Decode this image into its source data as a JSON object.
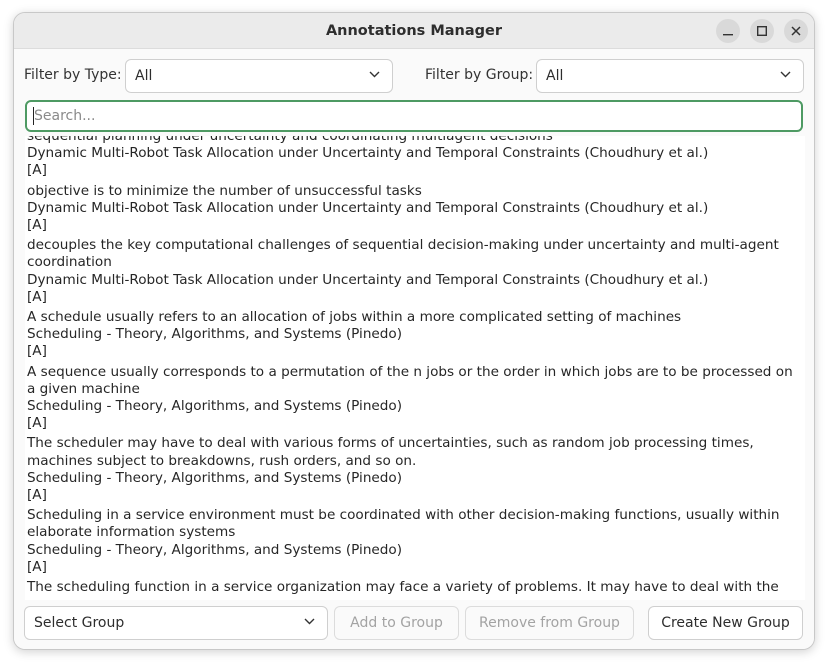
{
  "window": {
    "title": "Annotations Manager"
  },
  "filters": {
    "type_label": "Filter by Type:",
    "type_value": "All",
    "group_label": "Filter by Group:",
    "group_value": "All"
  },
  "search": {
    "placeholder": "Search..."
  },
  "annotations": [
    {
      "quote": "sequential planning under uncertainty and coordinating multiagent decisions",
      "source": "Dynamic Multi-Robot Task Allocation under Uncertainty and Temporal Constraints (Choudhury et al.)",
      "tag": "[A]"
    },
    {
      "quote": "objective is to minimize the number of unsuccessful tasks",
      "source": "Dynamic Multi-Robot Task Allocation under Uncertainty and Temporal Constraints (Choudhury et al.)",
      "tag": "[A]"
    },
    {
      "quote": "decouples the key computational challenges of sequential decision-making under uncertainty and multi-agent coordination",
      "source": "Dynamic Multi-Robot Task Allocation under Uncertainty and Temporal Constraints (Choudhury et al.)",
      "tag": "[A]"
    },
    {
      "quote": "A schedule usually refers to an allocation of jobs within a more complicated setting of machines",
      "source": "Scheduling - Theory, Algorithms, and Systems (Pinedo)",
      "tag": "[A]"
    },
    {
      "quote": "A sequence usually corresponds to a permutation of the n jobs or the order in which jobs are to be processed on a given machine",
      "source": "Scheduling - Theory, Algorithms, and Systems (Pinedo)",
      "tag": "[A]"
    },
    {
      "quote": "The scheduler may have to deal with various forms of uncertainties, such as random job processing times, machines subject to breakdowns, rush orders, and so on.",
      "source": "Scheduling - Theory, Algorithms, and Systems (Pinedo)",
      "tag": "[A]"
    },
    {
      "quote": "Scheduling in a service environment must be coordinated with other decision-making functions, usually within elaborate information systems",
      "source": "Scheduling - Theory, Algorithms, and Systems (Pinedo)",
      "tag": "[A]"
    },
    {
      "quote": "The scheduling function in a service organization may face a variety of problems. It may have to deal with the",
      "source": "",
      "tag": ""
    }
  ],
  "actions": {
    "select_group": "Select Group",
    "add_to_group": "Add to Group",
    "remove_from_group": "Remove from Group",
    "create_new_group": "Create New Group"
  }
}
